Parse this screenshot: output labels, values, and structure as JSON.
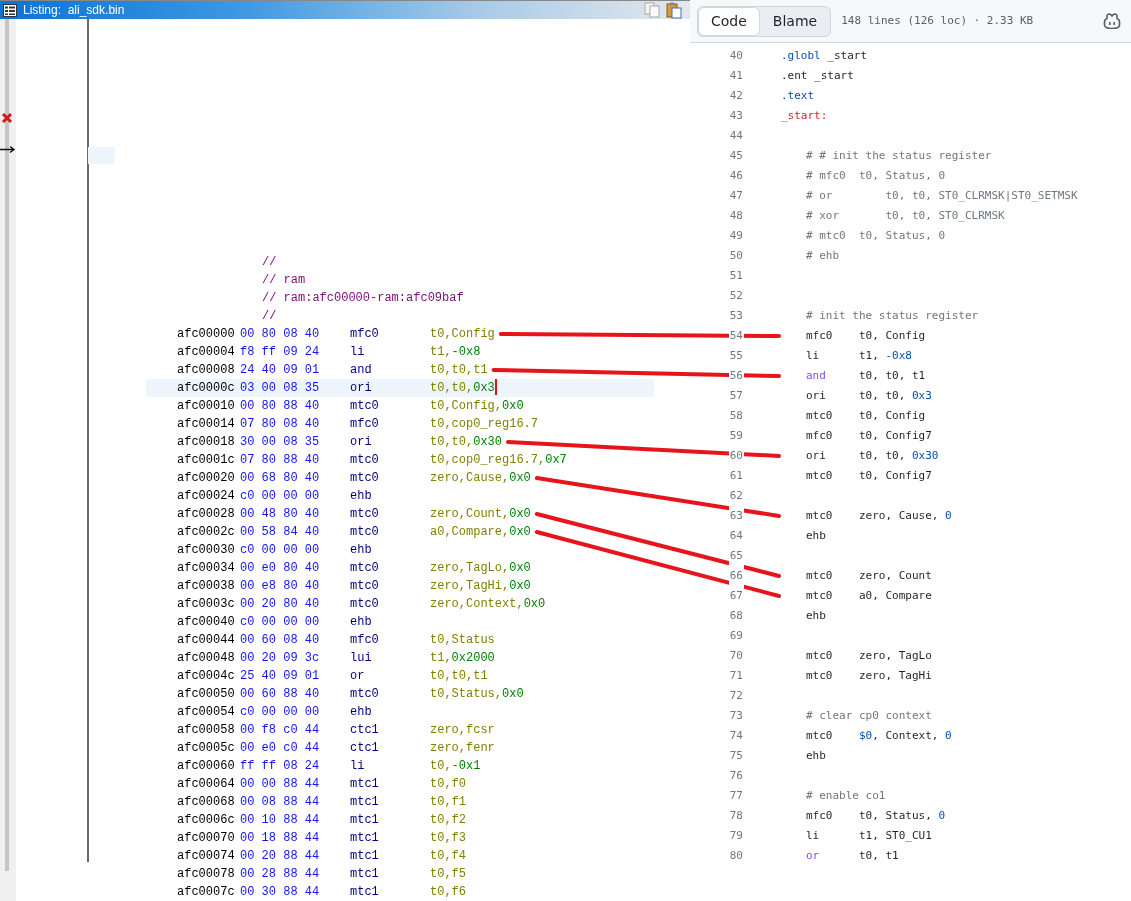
{
  "listing": {
    "title": "Listing:  ali_sdk.bin",
    "comments": [
      "//",
      "// ram",
      "// ram:afc00000-ram:afc09baf",
      "//"
    ],
    "rows": [
      {
        "address": "afc00000",
        "bytes": "00 80 08 40",
        "mnemonic": "mfc0",
        "operands": [
          {
            "text": "t0,Config",
            "kind": "reg"
          }
        ],
        "selected": false,
        "linked": true
      },
      {
        "address": "afc00004",
        "bytes": "f8 ff 09 24",
        "mnemonic": "li",
        "operands": [
          {
            "text": "t1,",
            "kind": "reg"
          },
          {
            "text": "-0x8",
            "kind": "imm"
          }
        ],
        "selected": false,
        "linked": false
      },
      {
        "address": "afc00008",
        "bytes": "24 40 09 01",
        "mnemonic": "and",
        "operands": [
          {
            "text": "t0,t0,t1",
            "kind": "reg"
          }
        ],
        "selected": false,
        "linked": true
      },
      {
        "address": "afc0000c",
        "bytes": "03 00 08 35",
        "mnemonic": "ori",
        "operands": [
          {
            "text": "t0,t0,",
            "kind": "reg"
          },
          {
            "text": "0x3",
            "kind": "imm"
          }
        ],
        "selected": true,
        "linked": false
      },
      {
        "address": "afc00010",
        "bytes": "00 80 88 40",
        "mnemonic": "mtc0",
        "operands": [
          {
            "text": "t0,Config,",
            "kind": "reg"
          },
          {
            "text": "0x0",
            "kind": "imm"
          }
        ],
        "selected": false,
        "linked": false
      },
      {
        "address": "afc00014",
        "bytes": "07 80 08 40",
        "mnemonic": "mfc0",
        "operands": [
          {
            "text": "t0,cop0_reg16.7",
            "kind": "reg"
          }
        ],
        "selected": false,
        "linked": false
      },
      {
        "address": "afc00018",
        "bytes": "30 00 08 35",
        "mnemonic": "ori",
        "operands": [
          {
            "text": "t0,t0,",
            "kind": "reg"
          },
          {
            "text": "0x30",
            "kind": "imm"
          }
        ],
        "selected": false,
        "linked": true
      },
      {
        "address": "afc0001c",
        "bytes": "07 80 88 40",
        "mnemonic": "mtc0",
        "operands": [
          {
            "text": "t0,cop0_reg16.7,",
            "kind": "reg"
          },
          {
            "text": "0x7",
            "kind": "imm"
          }
        ],
        "selected": false,
        "linked": false
      },
      {
        "address": "afc00020",
        "bytes": "00 68 80 40",
        "mnemonic": "mtc0",
        "operands": [
          {
            "text": "zero,Cause,",
            "kind": "reg"
          },
          {
            "text": "0x0",
            "kind": "imm"
          }
        ],
        "selected": false,
        "linked": true
      },
      {
        "address": "afc00024",
        "bytes": "c0 00 00 00",
        "mnemonic": "ehb",
        "selected": false,
        "linked": false
      },
      {
        "address": "afc00028",
        "bytes": "00 48 80 40",
        "mnemonic": "mtc0",
        "operands": [
          {
            "text": "zero,Count,",
            "kind": "reg"
          },
          {
            "text": "0x0",
            "kind": "imm"
          }
        ],
        "selected": false,
        "linked": true
      },
      {
        "address": "afc0002c",
        "bytes": "00 58 84 40",
        "mnemonic": "mtc0",
        "operands": [
          {
            "text": "a0,Compare,",
            "kind": "reg"
          },
          {
            "text": "0x0",
            "kind": "imm"
          }
        ],
        "selected": false,
        "linked": true
      },
      {
        "address": "afc00030",
        "bytes": "c0 00 00 00",
        "mnemonic": "ehb",
        "selected": false,
        "linked": false
      },
      {
        "address": "afc00034",
        "bytes": "00 e0 80 40",
        "mnemonic": "mtc0",
        "operands": [
          {
            "text": "zero,TagLo,",
            "kind": "reg"
          },
          {
            "text": "0x0",
            "kind": "imm"
          }
        ],
        "selected": false,
        "linked": false
      },
      {
        "address": "afc00038",
        "bytes": "00 e8 80 40",
        "mnemonic": "mtc0",
        "operands": [
          {
            "text": "zero,TagHi,",
            "kind": "reg"
          },
          {
            "text": "0x0",
            "kind": "imm"
          }
        ],
        "selected": false,
        "linked": false
      },
      {
        "address": "afc0003c",
        "bytes": "00 20 80 40",
        "mnemonic": "mtc0",
        "operands": [
          {
            "text": "zero,Context,",
            "kind": "reg"
          },
          {
            "text": "0x0",
            "kind": "imm"
          }
        ],
        "selected": false,
        "linked": false
      },
      {
        "address": "afc00040",
        "bytes": "c0 00 00 00",
        "mnemonic": "ehb",
        "selected": false,
        "linked": false
      },
      {
        "address": "afc00044",
        "bytes": "00 60 08 40",
        "mnemonic": "mfc0",
        "operands": [
          {
            "text": "t0,Status",
            "kind": "reg"
          }
        ],
        "selected": false,
        "linked": false
      },
      {
        "address": "afc00048",
        "bytes": "00 20 09 3c",
        "mnemonic": "lui",
        "operands": [
          {
            "text": "t1,",
            "kind": "reg"
          },
          {
            "text": "0x2000",
            "kind": "imm"
          }
        ],
        "selected": false,
        "linked": false
      },
      {
        "address": "afc0004c",
        "bytes": "25 40 09 01",
        "mnemonic": "or",
        "operands": [
          {
            "text": "t0,t0,t1",
            "kind": "reg"
          }
        ],
        "selected": false,
        "linked": false
      },
      {
        "address": "afc00050",
        "bytes": "00 60 88 40",
        "mnemonic": "mtc0",
        "operands": [
          {
            "text": "t0,Status,",
            "kind": "reg"
          },
          {
            "text": "0x0",
            "kind": "imm"
          }
        ],
        "selected": false,
        "linked": false
      },
      {
        "address": "afc00054",
        "bytes": "c0 00 00 00",
        "mnemonic": "ehb",
        "selected": false,
        "linked": false
      },
      {
        "address": "afc00058",
        "bytes": "00 f8 c0 44",
        "mnemonic": "ctc1",
        "operands": [
          {
            "text": "zero,fcsr",
            "kind": "reg"
          }
        ],
        "selected": false,
        "linked": false
      },
      {
        "address": "afc0005c",
        "bytes": "00 e0 c0 44",
        "mnemonic": "ctc1",
        "operands": [
          {
            "text": "zero,fenr",
            "kind": "reg"
          }
        ],
        "selected": false,
        "linked": false
      },
      {
        "address": "afc00060",
        "bytes": "ff ff 08 24",
        "mnemonic": "li",
        "operands": [
          {
            "text": "t0,",
            "kind": "reg"
          },
          {
            "text": "-0x1",
            "kind": "imm"
          }
        ],
        "selected": false,
        "linked": false
      },
      {
        "address": "afc00064",
        "bytes": "00 00 88 44",
        "mnemonic": "mtc1",
        "operands": [
          {
            "text": "t0,f0",
            "kind": "reg"
          }
        ],
        "selected": false,
        "linked": false
      },
      {
        "address": "afc00068",
        "bytes": "00 08 88 44",
        "mnemonic": "mtc1",
        "operands": [
          {
            "text": "t0,f1",
            "kind": "reg"
          }
        ],
        "selected": false,
        "linked": false
      },
      {
        "address": "afc0006c",
        "bytes": "00 10 88 44",
        "mnemonic": "mtc1",
        "operands": [
          {
            "text": "t0,f2",
            "kind": "reg"
          }
        ],
        "selected": false,
        "linked": false
      },
      {
        "address": "afc00070",
        "bytes": "00 18 88 44",
        "mnemonic": "mtc1",
        "operands": [
          {
            "text": "t0,f3",
            "kind": "reg"
          }
        ],
        "selected": false,
        "linked": false
      },
      {
        "address": "afc00074",
        "bytes": "00 20 88 44",
        "mnemonic": "mtc1",
        "operands": [
          {
            "text": "t0,f4",
            "kind": "reg"
          }
        ],
        "selected": false,
        "linked": false
      },
      {
        "address": "afc00078",
        "bytes": "00 28 88 44",
        "mnemonic": "mtc1",
        "operands": [
          {
            "text": "t0,f5",
            "kind": "reg"
          }
        ],
        "selected": false,
        "linked": false
      },
      {
        "address": "afc0007c",
        "bytes": "00 30 88 44",
        "mnemonic": "mtc1",
        "operands": [
          {
            "text": "t0,f6",
            "kind": "reg"
          }
        ],
        "selected": false,
        "linked": false
      }
    ]
  },
  "code": {
    "tabs": [
      {
        "label": "Code",
        "selected": true
      },
      {
        "label": "Blame",
        "selected": false
      }
    ],
    "info": "148 lines (126 loc) · 2.33 KB",
    "lines": [
      {
        "number": "40",
        "indented": false,
        "linked": false,
        "segments": [
          {
            "text": ".globl",
            "kind": "directive"
          },
          {
            "text": " _start",
            "kind": "plain"
          }
        ]
      },
      {
        "number": "41",
        "indented": false,
        "linked": false,
        "segments": [
          {
            "text": ".ent _start",
            "kind": "plain"
          }
        ]
      },
      {
        "number": "42",
        "indented": false,
        "linked": false,
        "segments": [
          {
            "text": ".text",
            "kind": "directive"
          }
        ]
      },
      {
        "number": "43",
        "indented": false,
        "linked": false,
        "segments": [
          {
            "text": "_start:",
            "kind": "label"
          }
        ]
      },
      {
        "number": "44",
        "linked": false
      },
      {
        "number": "45",
        "indented": true,
        "linked": false,
        "segments": [
          {
            "text": "# # init the status register",
            "kind": "comment"
          }
        ]
      },
      {
        "number": "46",
        "indented": true,
        "linked": false,
        "segments": [
          {
            "text": "# mfc0  t0, Status, 0",
            "kind": "comment"
          }
        ]
      },
      {
        "number": "47",
        "indented": true,
        "linked": false,
        "segments": [
          {
            "text": "# or        t0, t0, ST0_CLRMSK|ST0_SETMSK",
            "kind": "comment"
          }
        ]
      },
      {
        "number": "48",
        "indented": true,
        "linked": false,
        "segments": [
          {
            "text": "# xor       t0, t0, ST0_CLRMSK",
            "kind": "comment"
          }
        ]
      },
      {
        "number": "49",
        "indented": true,
        "linked": false,
        "segments": [
          {
            "text": "# mtc0  t0, Status, 0",
            "kind": "comment"
          }
        ]
      },
      {
        "number": "50",
        "indented": true,
        "linked": false,
        "segments": [
          {
            "text": "# ehb",
            "kind": "comment"
          }
        ]
      },
      {
        "number": "51",
        "linked": false
      },
      {
        "number": "52",
        "linked": false
      },
      {
        "number": "53",
        "indented": true,
        "linked": false,
        "segments": [
          {
            "text": "# init the status register",
            "kind": "comment"
          }
        ]
      },
      {
        "number": "54",
        "indented": true,
        "linked": true,
        "segments": [
          {
            "text": "mfc0    t0, Config",
            "kind": "plain"
          }
        ]
      },
      {
        "number": "55",
        "indented": true,
        "linked": false,
        "segments": [
          {
            "text": "li      t1, ",
            "kind": "plain"
          },
          {
            "text": "-0x8",
            "kind": "number"
          }
        ]
      },
      {
        "number": "56",
        "indented": true,
        "linked": true,
        "segments": [
          {
            "text": "and",
            "kind": "keyword"
          },
          {
            "text": "     t0, t0, t1",
            "kind": "plain"
          }
        ]
      },
      {
        "number": "57",
        "indented": true,
        "linked": false,
        "segments": [
          {
            "text": "ori     t0, t0, ",
            "kind": "plain"
          },
          {
            "text": "0x3",
            "kind": "number"
          }
        ]
      },
      {
        "number": "58",
        "indented": true,
        "linked": false,
        "segments": [
          {
            "text": "mtc0    t0, Config",
            "kind": "plain"
          }
        ]
      },
      {
        "number": "59",
        "indented": true,
        "linked": false,
        "segments": [
          {
            "text": "mfc0    t0, Config7",
            "kind": "plain"
          }
        ]
      },
      {
        "number": "60",
        "indented": true,
        "linked": true,
        "segments": [
          {
            "text": "ori     t0, t0, ",
            "kind": "plain"
          },
          {
            "text": "0x30",
            "kind": "number"
          }
        ]
      },
      {
        "number": "61",
        "indented": true,
        "linked": false,
        "segments": [
          {
            "text": "mtc0    t0, Config7",
            "kind": "plain"
          }
        ]
      },
      {
        "number": "62",
        "linked": false
      },
      {
        "number": "63",
        "indented": true,
        "linked": true,
        "segments": [
          {
            "text": "mtc0    zero, Cause, ",
            "kind": "plain"
          },
          {
            "text": "0",
            "kind": "number"
          }
        ]
      },
      {
        "number": "64",
        "indented": true,
        "linked": false,
        "segments": [
          {
            "text": "ehb",
            "kind": "plain"
          }
        ]
      },
      {
        "number": "65",
        "linked": false
      },
      {
        "number": "66",
        "indented": true,
        "linked": true,
        "segments": [
          {
            "text": "mtc0    zero, Count",
            "kind": "plain"
          }
        ]
      },
      {
        "number": "67",
        "indented": true,
        "linked": true,
        "segments": [
          {
            "text": "mtc0    a0, Compare",
            "kind": "plain"
          }
        ]
      },
      {
        "number": "68",
        "indented": true,
        "linked": false,
        "segments": [
          {
            "text": "ehb",
            "kind": "plain"
          }
        ]
      },
      {
        "number": "69",
        "linked": false
      },
      {
        "number": "70",
        "indented": true,
        "linked": false,
        "segments": [
          {
            "text": "mtc0    zero, TagLo",
            "kind": "plain"
          }
        ]
      },
      {
        "number": "71",
        "indented": true,
        "linked": false,
        "segments": [
          {
            "text": "mtc0    zero, TagHi",
            "kind": "plain"
          }
        ]
      },
      {
        "number": "72",
        "linked": false
      },
      {
        "number": "73",
        "indented": true,
        "linked": false,
        "segments": [
          {
            "text": "# clear cp0 context",
            "kind": "comment"
          }
        ]
      },
      {
        "number": "74",
        "indented": true,
        "linked": false,
        "segments": [
          {
            "text": "mtc0    ",
            "kind": "plain"
          },
          {
            "text": "$0",
            "kind": "number"
          },
          {
            "text": ", Context, ",
            "kind": "plain"
          },
          {
            "text": "0",
            "kind": "number"
          }
        ]
      },
      {
        "number": "75",
        "indented": true,
        "linked": false,
        "segments": [
          {
            "text": "ehb",
            "kind": "plain"
          }
        ]
      },
      {
        "number": "76",
        "linked": false
      },
      {
        "number": "77",
        "indented": true,
        "linked": false,
        "segments": [
          {
            "text": "# enable co1",
            "kind": "comment"
          }
        ]
      },
      {
        "number": "78",
        "indented": true,
        "linked": false,
        "segments": [
          {
            "text": "mfc0    t0, Status, ",
            "kind": "plain"
          },
          {
            "text": "0",
            "kind": "number"
          }
        ]
      },
      {
        "number": "79",
        "indented": true,
        "linked": false,
        "segments": [
          {
            "text": "li      t1, ST0_CU1",
            "kind": "plain"
          }
        ]
      },
      {
        "number": "80",
        "indented": true,
        "linked": false,
        "segments": [
          {
            "text": "or",
            "kind": "keyword"
          },
          {
            "text": "      t0, t1",
            "kind": "plain"
          }
        ]
      }
    ]
  }
}
